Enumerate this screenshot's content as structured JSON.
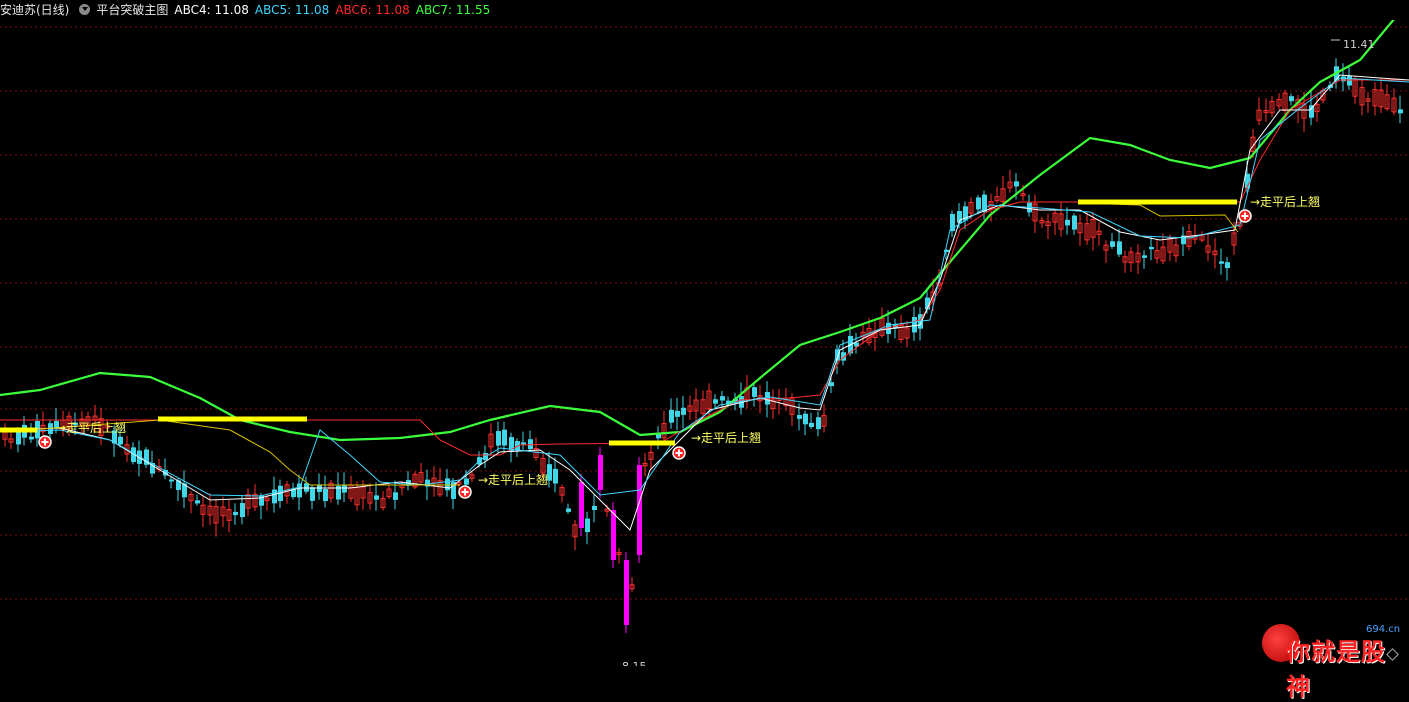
{
  "header": {
    "stock": "安迪苏(日线)",
    "indicator": "平台突破主图",
    "abc4": "ABC4: 11.08",
    "abc5": "ABC5: 11.08",
    "abc6": "ABC6: 11.08",
    "abc7": "ABC7: 11.55"
  },
  "colors": {
    "background": "#000000",
    "grid": "#7a1010",
    "up_candle": "#ff3030",
    "down_candle": "#40d8e8",
    "special_candle": "#ff00ff",
    "abc4": "#ffffff",
    "abc5": "#3fd6ff",
    "abc6": "#ff2b2b",
    "abc7": "#3bff3b",
    "platform": "#ffff00",
    "breakout_text": "#ffff66"
  },
  "chart_data": {
    "type": "candlestick",
    "title": "安迪苏(日线)",
    "y_labels": {
      "high": "11.41",
      "low": "8.15"
    },
    "high": 11.41,
    "low": 8.15,
    "breakout_signals": [
      {
        "label": "走平后上翘",
        "index": 1
      },
      {
        "label": "走平后上翘",
        "index": 2
      },
      {
        "label": "走平后上翘",
        "index": 3
      },
      {
        "label": "走平后上翘",
        "index": 4
      }
    ],
    "watermark": {
      "text": "你就是股神",
      "url": "694.cn"
    }
  }
}
